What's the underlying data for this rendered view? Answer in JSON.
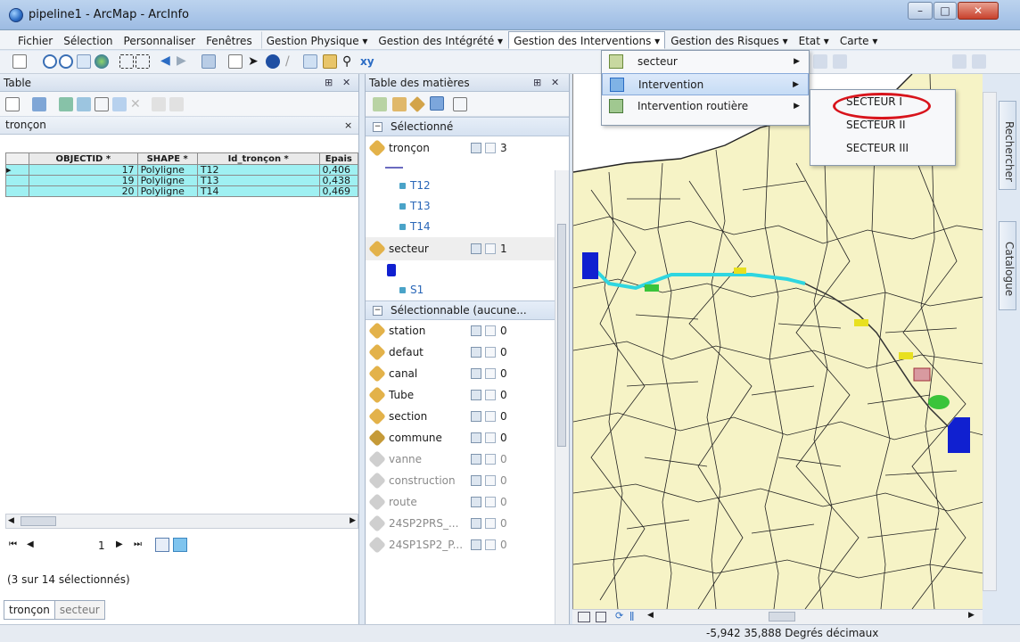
{
  "window": {
    "title": "pipeline1 - ArcMap - ArcInfo",
    "min": "–",
    "max": "□",
    "close": "✕"
  },
  "menubar": [
    {
      "label": "Fichier"
    },
    {
      "label": "Sélection"
    },
    {
      "label": "Personnaliser"
    },
    {
      "label": "Fenêtres"
    },
    {
      "label": "Gestion Physique ▾"
    },
    {
      "label": "Gestion des Intégrété ▾"
    },
    {
      "label": "Gestion des Interventions ▾"
    },
    {
      "label": "Gestion des Risques ▾"
    },
    {
      "label": "Etat ▾"
    },
    {
      "label": "Carte ▾"
    }
  ],
  "interventions_menu": {
    "items": [
      {
        "label": "secteur"
      },
      {
        "label": "Intervention"
      },
      {
        "label": "Intervention routière"
      }
    ],
    "submenu": [
      {
        "label": "SECTEUR I"
      },
      {
        "label": "SECTEUR II"
      },
      {
        "label": "SECTEUR III"
      }
    ]
  },
  "table_panel": {
    "title": "Table",
    "pin": "⊞",
    "close": "✕",
    "layer_tab": "tronçon",
    "columns": [
      "OBJECTID *",
      "SHAPE *",
      "Id_tronçon *",
      "Epais"
    ],
    "rows": [
      [
        "17",
        "Polyligne",
        "T12",
        "0,406"
      ],
      [
        "19",
        "Polyligne",
        "T13",
        "0,438"
      ],
      [
        "20",
        "Polyligne",
        "T14",
        "0,469"
      ]
    ],
    "record_number": "1",
    "selection_count": "(3 sur 14 sélectionnés)",
    "tabs": [
      "tronçon",
      "secteur"
    ]
  },
  "toc_panel": {
    "title": "Table des matières",
    "group_selected": "Sélectionné",
    "group_selectable": "Sélectionnable (aucune...",
    "selected_layers": [
      {
        "name": "tronçon",
        "count": "3",
        "features": [
          "T12",
          "T13",
          "T14"
        ]
      },
      {
        "name": "secteur",
        "count": "1",
        "features": [
          "S1"
        ]
      }
    ],
    "selectable_layers": [
      {
        "name": "station",
        "count": "0",
        "dim": false
      },
      {
        "name": "defaut",
        "count": "0",
        "dim": false
      },
      {
        "name": "canal",
        "count": "0",
        "dim": false
      },
      {
        "name": "Tube",
        "count": "0",
        "dim": false
      },
      {
        "name": "section",
        "count": "0",
        "dim": false
      },
      {
        "name": "commune",
        "count": "0",
        "dim": false
      },
      {
        "name": "vanne",
        "count": "0",
        "dim": true
      },
      {
        "name": "construction",
        "count": "0",
        "dim": true
      },
      {
        "name": "route",
        "count": "0",
        "dim": true
      },
      {
        "name": "24SP2PRS_...",
        "count": "0",
        "dim": true
      },
      {
        "name": "24SP1SP2_P...",
        "count": "0",
        "dim": true
      }
    ]
  },
  "side_tabs": [
    "Rechercher",
    "Catalogue"
  ],
  "status": {
    "coords": "-5,942  35,888 Degrés décimaux"
  },
  "colors": {
    "selection_row": "#9ff0f2",
    "map_fill": "#f6f3c6",
    "pipeline": "#2fd6e0",
    "ring": "#d8141c"
  }
}
